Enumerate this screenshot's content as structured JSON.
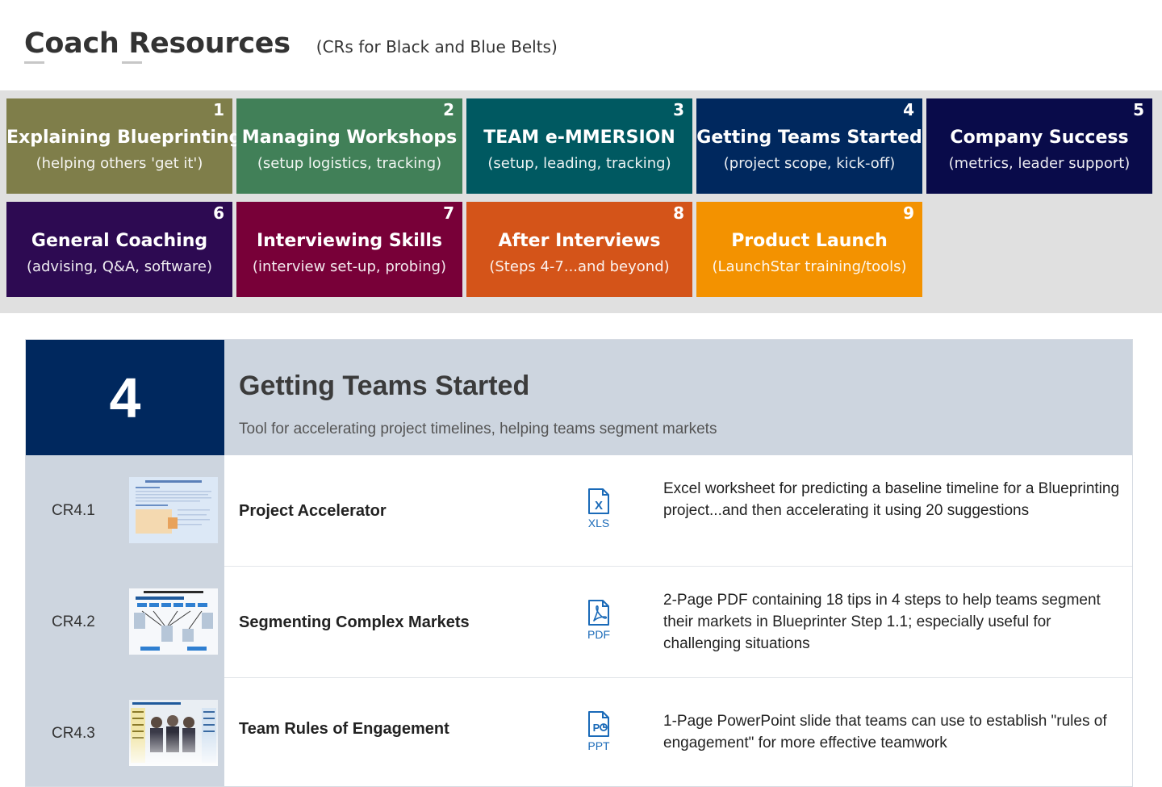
{
  "header": {
    "title": "Coach Resources",
    "subtitle": "(CRs for Black and Blue Belts)"
  },
  "tiles": [
    {
      "num": "1",
      "title": "Explaining Blueprinting",
      "sub": "(helping others 'get it')",
      "color": "#7f7e4a"
    },
    {
      "num": "2",
      "title": "Managing Workshops",
      "sub": "(setup logistics, tracking)",
      "color": "#418058"
    },
    {
      "num": "3",
      "title": "TEAM e-MMERSION",
      "sub": "(setup, leading, tracking)",
      "color": "#005961"
    },
    {
      "num": "4",
      "title": "Getting Teams Started",
      "sub": "(project scope, kick-off)",
      "color": "#00285e"
    },
    {
      "num": "5",
      "title": "Company Success",
      "sub": "(metrics, leader support)",
      "color": "#090b4a"
    },
    {
      "num": "6",
      "title": "General Coaching",
      "sub": "(advising, Q&A, software)",
      "color": "#2d0a52"
    },
    {
      "num": "7",
      "title": "Interviewing Skills",
      "sub": "(interview set-up, probing)",
      "color": "#780038"
    },
    {
      "num": "8",
      "title": "After Interviews",
      "sub": "(Steps 4-7...and beyond)",
      "color": "#d45419"
    },
    {
      "num": "9",
      "title": "Product Launch",
      "sub": "(LaunchStar training/tools)",
      "color": "#f39200"
    }
  ],
  "section": {
    "number": "4",
    "title": "Getting Teams Started",
    "description": "Tool for accelerating project timelines, helping teams segment markets"
  },
  "rows": [
    {
      "id": "CR4.1",
      "name": "Project Accelerator",
      "file_type": "XLS",
      "icon": "excel-file-icon",
      "description": "Excel worksheet for predicting a baseline timeline for a Blueprinting project...and then accelerating it using 20 suggestions"
    },
    {
      "id": "CR4.2",
      "name": "Segmenting Complex Markets",
      "file_type": "PDF",
      "icon": "pdf-file-icon",
      "description": "2-Page PDF containing 18 tips in 4 steps to help teams segment their markets in Blueprinter Step 1.1; especially useful for challenging situations"
    },
    {
      "id": "CR4.3",
      "name": "Team Rules of Engagement",
      "file_type": "PPT",
      "icon": "powerpoint-file-icon",
      "description": "1-Page PowerPoint slide that teams can use to establish \"rules of engagement\" for more effective teamwork"
    }
  ]
}
